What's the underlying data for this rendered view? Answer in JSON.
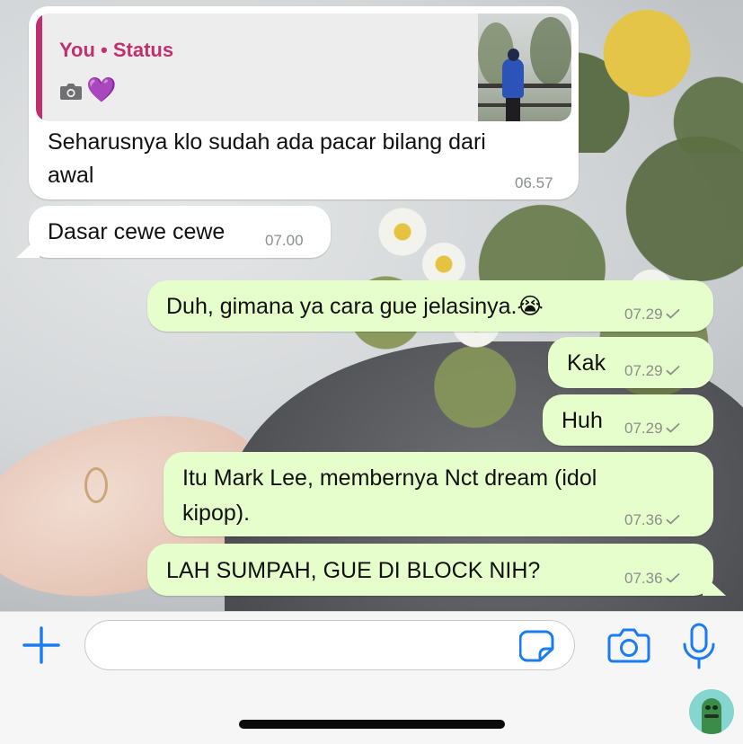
{
  "chat": {
    "messages": [
      {
        "direction": "incoming",
        "quote": {
          "title": "You • Status",
          "media_icon": "camera-icon",
          "emoji": "💜"
        },
        "lines": [
          "Seharusnya klo sudah ada pacar bilang dari",
          "awal"
        ],
        "time": "06.57"
      },
      {
        "direction": "incoming",
        "lines": [
          "Dasar cewe cewe"
        ],
        "time": "07.00"
      },
      {
        "direction": "outgoing",
        "lines": [
          "Duh, gimana ya cara gue jelasinya.😭"
        ],
        "time": "07.29",
        "status": "sent-check-icon"
      },
      {
        "direction": "outgoing",
        "lines": [
          "Kak"
        ],
        "time": "07.29",
        "status": "sent-check-icon"
      },
      {
        "direction": "outgoing",
        "lines": [
          "Huh"
        ],
        "time": "07.29",
        "status": "sent-check-icon"
      },
      {
        "direction": "outgoing",
        "lines": [
          "Itu Mark Lee, membernya Nct dream (idol",
          "kipop)."
        ],
        "time": "07.36",
        "status": "sent-check-icon"
      },
      {
        "direction": "outgoing",
        "lines": [
          "LAH SUMPAH, GUE DI BLOCK NIH?"
        ],
        "time": "07.36",
        "status": "sent-check-icon"
      }
    ]
  },
  "composer": {
    "input_value": "",
    "icons": [
      "plus-icon",
      "sticker-icon",
      "camera-icon",
      "microphone-icon"
    ]
  },
  "colors": {
    "incoming_bubble": "#ffffff",
    "outgoing_bubble": "#e6fecb",
    "accent_blue": "#1b7cf0",
    "status_quote": "#c1306e"
  }
}
